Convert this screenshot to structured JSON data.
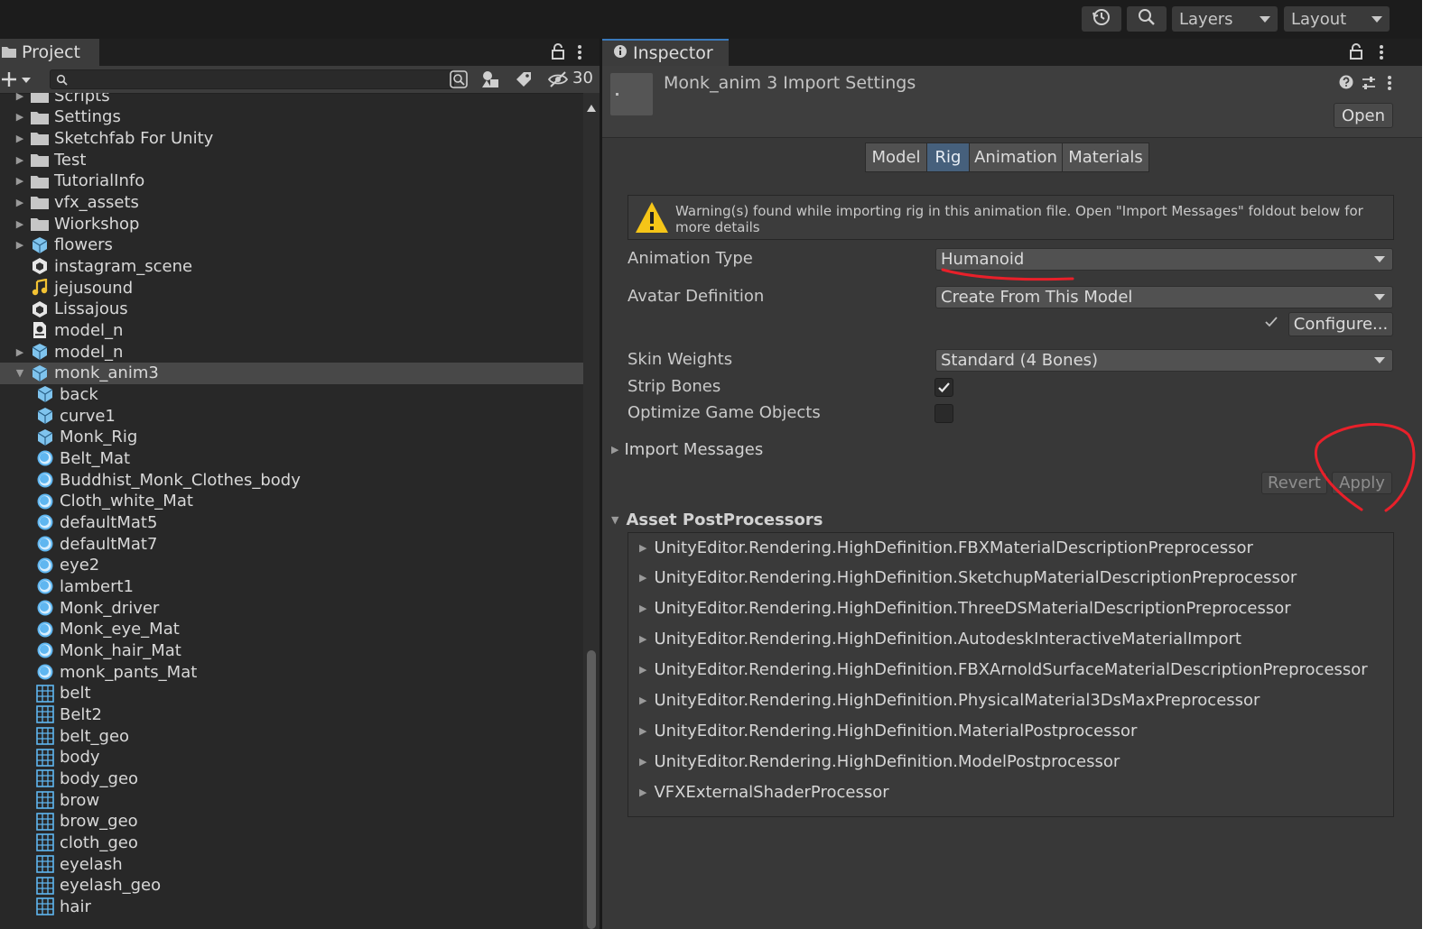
{
  "toolbar": {
    "history_icon": "history-icon",
    "search_icon": "search-icon",
    "layers_label": "Layers",
    "layout_label": "Layout"
  },
  "project": {
    "tab_label": "Project",
    "hidden_count": "30",
    "items": [
      {
        "label": "Scripts",
        "icon": "folder",
        "indent": 0,
        "arrow": "collapsed"
      },
      {
        "label": "Settings",
        "icon": "folder",
        "indent": 0,
        "arrow": "collapsed"
      },
      {
        "label": "Sketchfab For Unity",
        "icon": "folder",
        "indent": 0,
        "arrow": "collapsed"
      },
      {
        "label": "Test",
        "icon": "folder",
        "indent": 0,
        "arrow": "collapsed"
      },
      {
        "label": "TutorialInfo",
        "icon": "folder",
        "indent": 0,
        "arrow": "collapsed"
      },
      {
        "label": "vfx_assets",
        "icon": "folder",
        "indent": 0,
        "arrow": "collapsed"
      },
      {
        "label": "Wiorkshop",
        "icon": "folder",
        "indent": 0,
        "arrow": "collapsed"
      },
      {
        "label": "flowers",
        "icon": "model",
        "indent": 0,
        "arrow": "collapsed"
      },
      {
        "label": "instagram_scene",
        "icon": "scene",
        "indent": 0,
        "arrow": "none"
      },
      {
        "label": "jejusound",
        "icon": "audio",
        "indent": 0,
        "arrow": "none"
      },
      {
        "label": "Lissajous",
        "icon": "scene",
        "indent": 0,
        "arrow": "none"
      },
      {
        "label": "model_n",
        "icon": "mtl",
        "indent": 0,
        "arrow": "none"
      },
      {
        "label": "model_n",
        "icon": "model",
        "indent": 0,
        "arrow": "collapsed"
      },
      {
        "label": "monk_anim3",
        "icon": "model",
        "indent": 0,
        "arrow": "expanded",
        "selected": true
      },
      {
        "label": "back",
        "icon": "model",
        "indent": 1,
        "arrow": "none"
      },
      {
        "label": "curve1",
        "icon": "model",
        "indent": 1,
        "arrow": "none"
      },
      {
        "label": "Monk_Rig",
        "icon": "model",
        "indent": 1,
        "arrow": "none"
      },
      {
        "label": "Belt_Mat",
        "icon": "material",
        "indent": 1,
        "arrow": "none"
      },
      {
        "label": "Buddhist_Monk_Clothes_body",
        "icon": "material",
        "indent": 1,
        "arrow": "none"
      },
      {
        "label": "Cloth_white_Mat",
        "icon": "material",
        "indent": 1,
        "arrow": "none"
      },
      {
        "label": "defaultMat5",
        "icon": "material",
        "indent": 1,
        "arrow": "none"
      },
      {
        "label": "defaultMat7",
        "icon": "material",
        "indent": 1,
        "arrow": "none"
      },
      {
        "label": "eye2",
        "icon": "material",
        "indent": 1,
        "arrow": "none"
      },
      {
        "label": "lambert1",
        "icon": "material",
        "indent": 1,
        "arrow": "none"
      },
      {
        "label": "Monk_driver",
        "icon": "material",
        "indent": 1,
        "arrow": "none"
      },
      {
        "label": "Monk_eye_Mat",
        "icon": "material",
        "indent": 1,
        "arrow": "none"
      },
      {
        "label": "Monk_hair_Mat",
        "icon": "material",
        "indent": 1,
        "arrow": "none"
      },
      {
        "label": "monk_pants_Mat",
        "icon": "material",
        "indent": 1,
        "arrow": "none"
      },
      {
        "label": "belt",
        "icon": "mesh",
        "indent": 1,
        "arrow": "none"
      },
      {
        "label": "Belt2",
        "icon": "mesh",
        "indent": 1,
        "arrow": "none"
      },
      {
        "label": "belt_geo",
        "icon": "mesh",
        "indent": 1,
        "arrow": "none"
      },
      {
        "label": "body",
        "icon": "mesh",
        "indent": 1,
        "arrow": "none"
      },
      {
        "label": "body_geo",
        "icon": "mesh",
        "indent": 1,
        "arrow": "none"
      },
      {
        "label": "brow",
        "icon": "mesh",
        "indent": 1,
        "arrow": "none"
      },
      {
        "label": "brow_geo",
        "icon": "mesh",
        "indent": 1,
        "arrow": "none"
      },
      {
        "label": "cloth_geo",
        "icon": "mesh",
        "indent": 1,
        "arrow": "none"
      },
      {
        "label": "eyelash",
        "icon": "mesh",
        "indent": 1,
        "arrow": "none"
      },
      {
        "label": "eyelash_geo",
        "icon": "mesh",
        "indent": 1,
        "arrow": "none"
      },
      {
        "label": "hair",
        "icon": "mesh",
        "indent": 1,
        "arrow": "none"
      }
    ]
  },
  "inspector": {
    "tab_label": "Inspector",
    "title": "Monk_anim 3 Import Settings",
    "open_button": "Open",
    "tabs": [
      "Model",
      "Rig",
      "Animation",
      "Materials"
    ],
    "active_tab": "Rig",
    "warning": "Warning(s) found while importing rig in this animation file. Open \"Import Messages\" foldout below for more details",
    "animation_type_label": "Animation Type",
    "animation_type_value": "Humanoid",
    "avatar_definition_label": "Avatar Definition",
    "avatar_definition_value": "Create From This Model",
    "configure_button": "Configure...",
    "skin_weights_label": "Skin Weights",
    "skin_weights_value": "Standard (4 Bones)",
    "strip_bones_label": "Strip Bones",
    "strip_bones_checked": true,
    "optimize_label": "Optimize Game Objects",
    "optimize_checked": false,
    "import_messages_label": "Import Messages",
    "revert_button": "Revert",
    "apply_button": "Apply",
    "postprocessors_label": "Asset PostProcessors",
    "postprocessors": [
      "UnityEditor.Rendering.HighDefinition.FBXMaterialDescriptionPreprocessor",
      "UnityEditor.Rendering.HighDefinition.SketchupMaterialDescriptionPreprocessor",
      "UnityEditor.Rendering.HighDefinition.ThreeDSMaterialDescriptionPreprocessor",
      "UnityEditor.Rendering.HighDefinition.AutodeskInteractiveMaterialImport",
      "UnityEditor.Rendering.HighDefinition.FBXArnoldSurfaceMaterialDescriptionPreprocessor",
      "UnityEditor.Rendering.HighDefinition.PhysicalMaterial3DsMaxPreprocessor",
      "UnityEditor.Rendering.HighDefinition.MaterialPostprocessor",
      "UnityEditor.Rendering.HighDefinition.ModelPostprocessor",
      "VFXExternalShaderProcessor"
    ]
  },
  "colors": {
    "annotation_red": "#e8202a",
    "accent_blue": "#3a79bb",
    "icon_blue": "#5fb6f0",
    "warning_yellow": "#f5c518"
  }
}
